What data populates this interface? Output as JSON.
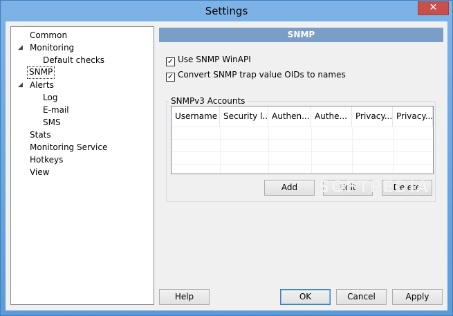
{
  "window": {
    "title": "Settings",
    "close_label": "✕"
  },
  "tree": {
    "items": [
      {
        "label": "Common"
      },
      {
        "label": "Monitoring",
        "expander": "◢"
      },
      {
        "label": "Default checks"
      },
      {
        "label": "SNMP",
        "selected": true
      },
      {
        "label": "Alerts",
        "expander": "◢"
      },
      {
        "label": "Log"
      },
      {
        "label": "E-mail"
      },
      {
        "label": "SMS"
      },
      {
        "label": "Stats"
      },
      {
        "label": "Monitoring Service"
      },
      {
        "label": "Hotkeys"
      },
      {
        "label": "View"
      }
    ]
  },
  "panel": {
    "header": "SNMP",
    "checks": [
      {
        "label": "Use SNMP WinAPI",
        "checked": true,
        "mark": "✓"
      },
      {
        "label": "Convert SNMP trap value OIDs to names",
        "checked": true,
        "mark": "✓"
      }
    ],
    "group_label": "SNMPv3 Accounts",
    "columns": [
      "Username",
      "Security l...",
      "Authen...",
      "Authe...",
      "Privacy...",
      "Privacy..."
    ],
    "buttons": {
      "add": "Add",
      "edit": "Edit",
      "delete": "Delete"
    }
  },
  "footer": {
    "help": "Help",
    "ok": "OK",
    "cancel": "Cancel",
    "apply": "Apply"
  },
  "watermark": "SOFTPEDIA"
}
